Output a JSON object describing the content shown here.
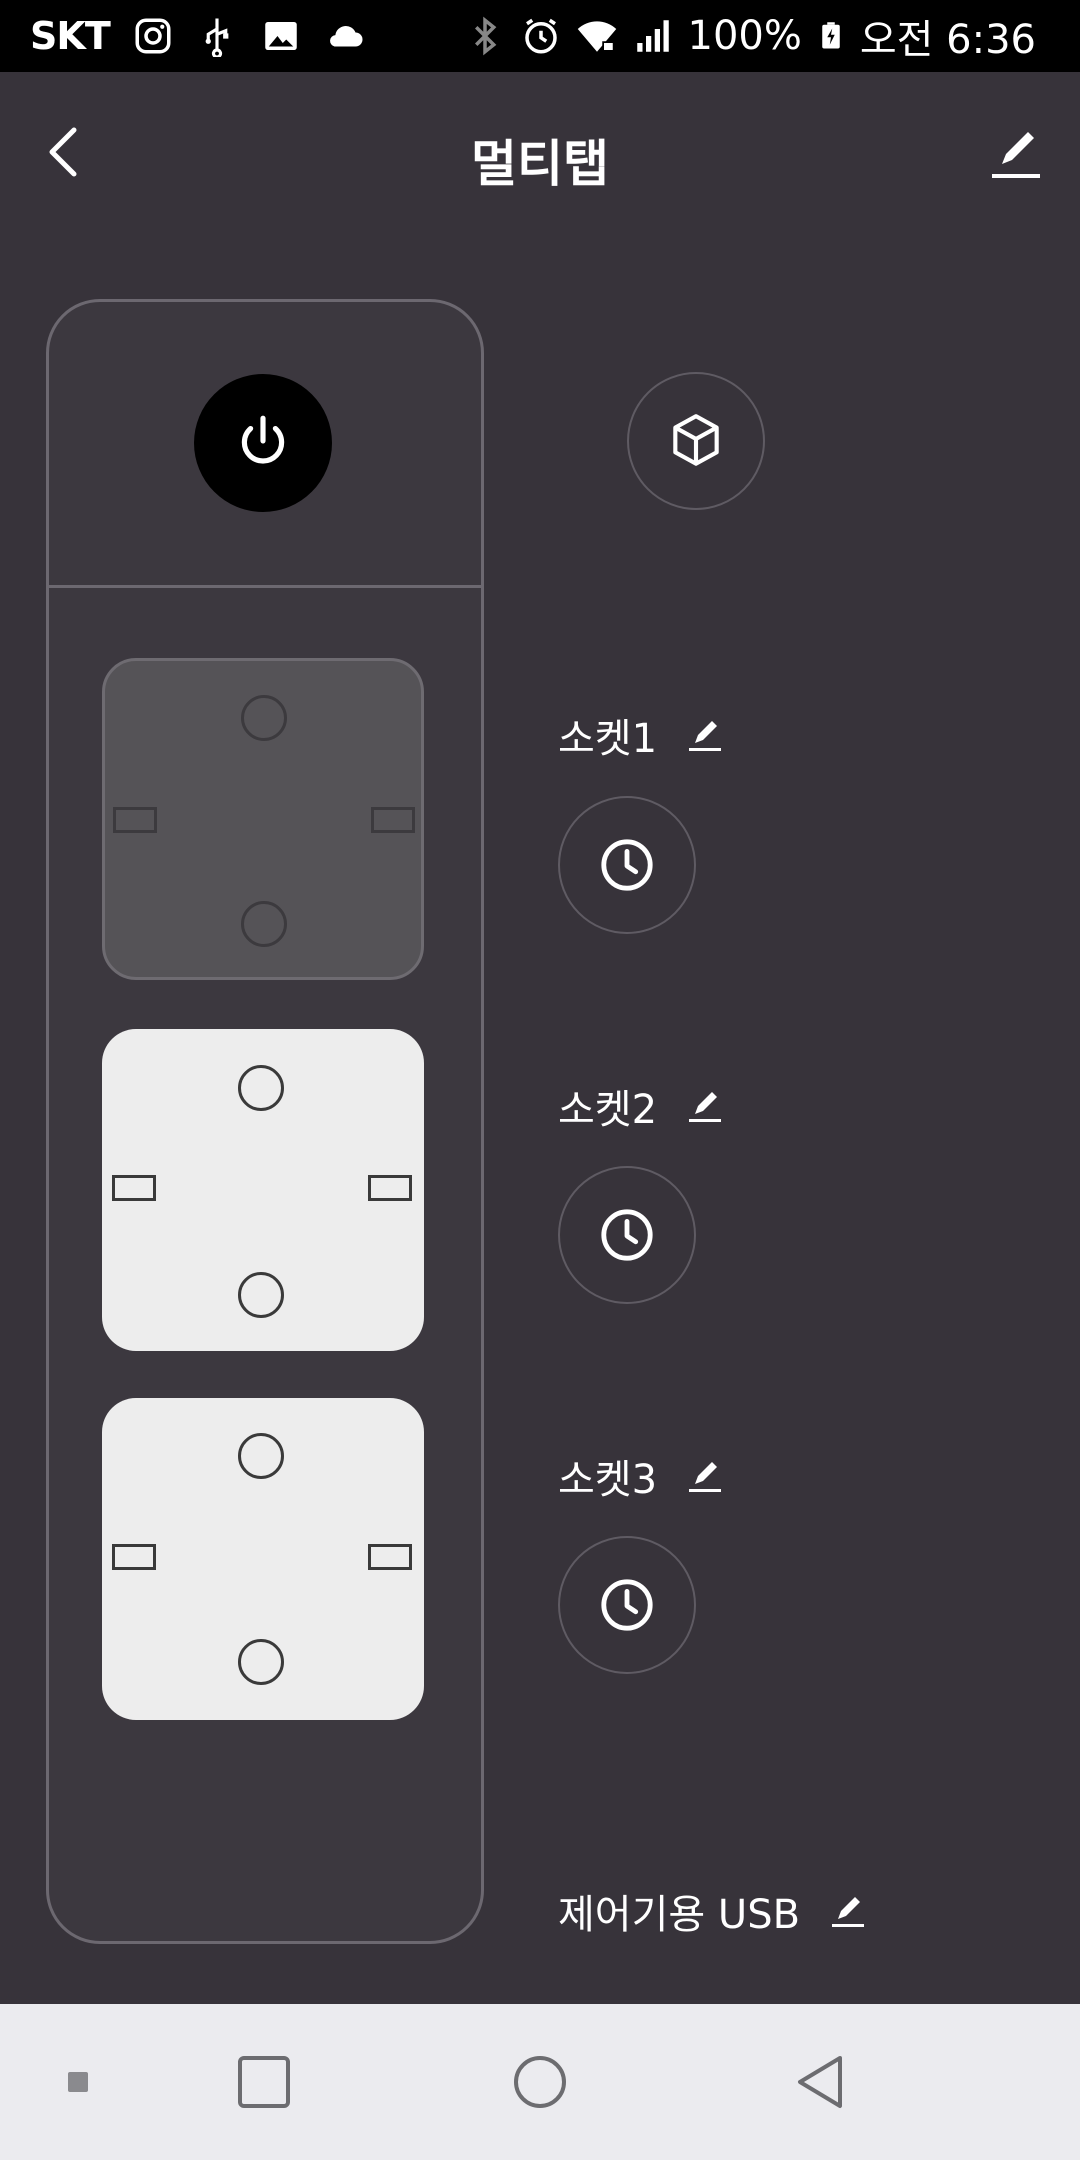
{
  "status_bar": {
    "carrier": "SKT",
    "battery": "100%",
    "time": "오전 6:36",
    "left_icons": [
      "instagram-icon",
      "usb-icon",
      "image-icon",
      "cloud-icon"
    ],
    "right_icons": [
      "bluetooth-icon",
      "alarm-icon",
      "wifi-locked-icon",
      "signal-icon",
      "battery-charging-icon"
    ]
  },
  "app_bar": {
    "title": "멀티탭",
    "back_icon": "chevron-left-icon",
    "edit_icon": "pencil-icon"
  },
  "multitap": {
    "power_icon": "power-icon",
    "cube_icon": "cube-icon",
    "sockets": [
      {
        "label": "소켓1",
        "state": "off",
        "timer_icon": "clock-icon"
      },
      {
        "label": "소켓2",
        "state": "on",
        "timer_icon": "clock-icon"
      },
      {
        "label": "소켓3",
        "state": "on",
        "timer_icon": "clock-icon"
      }
    ],
    "usb_label": "제어기용 USB"
  },
  "nav_bar": {
    "items": [
      "dot-icon",
      "recent-apps-icon",
      "home-icon",
      "back-icon"
    ]
  },
  "colors": {
    "background": "#37333a",
    "strip": "#3c383f",
    "socket_on": "#ededed",
    "socket_off": "#555357",
    "nav_bar": "#ebebef"
  }
}
